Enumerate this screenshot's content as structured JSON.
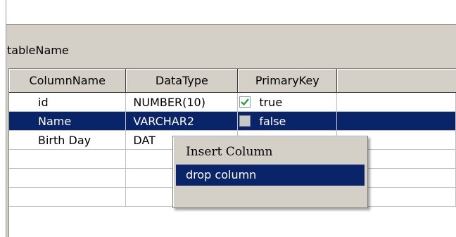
{
  "table": {
    "name": "tableName"
  },
  "grid": {
    "columns": [
      "ColumnName",
      "DataType",
      "PrimaryKey"
    ],
    "rows": [
      {
        "column_name": "id",
        "data_type": "NUMBER(10)",
        "primary_key": "true",
        "checked": true
      },
      {
        "column_name": "Name",
        "data_type": "VARCHAR2",
        "primary_key": "false",
        "checked": false,
        "selected": true
      },
      {
        "column_name": "Birth Day",
        "data_type": "DAT",
        "primary_key": "",
        "checked": false
      },
      {
        "column_name": "",
        "data_type": "",
        "primary_key": "",
        "checked": false
      },
      {
        "column_name": "",
        "data_type": "",
        "primary_key": "",
        "checked": false
      },
      {
        "column_name": "",
        "data_type": "",
        "primary_key": "false",
        "checked": false
      }
    ]
  },
  "context_menu": {
    "items": [
      {
        "label": "Insert Column"
      },
      {
        "label": "drop column",
        "highlighted": true
      }
    ]
  },
  "colors": {
    "selection": "#0a246a",
    "window": "#d4d0c8"
  }
}
